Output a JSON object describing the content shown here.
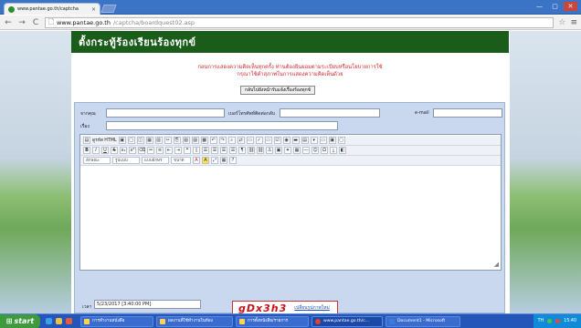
{
  "browser": {
    "tab_title": "www.pantae.go.th/captcha",
    "tab_close": "×",
    "window_buttons": [
      "—",
      "▢",
      "✕"
    ],
    "back_icon": "←",
    "forward_icon": "→",
    "reload_icon": "C",
    "url_host": "www.pantae.go.th",
    "url_path": "/captcha/boardquest02.asp",
    "bookmark_icon": "☆",
    "menu_icon": "≡"
  },
  "page": {
    "banner_title": "ตั้งกระทู้ร้องเรียนร้องทุกข์",
    "notice_line1": "ก่อนการแสดงความคิดเห็นทุกครั้ง ท่านต้องยินยอมตามระเบียบหรือนโยบายการใช้",
    "notice_line2": "กรุณาใช้คำสุภาพในการแสดงความคิดเห็นด้วย",
    "back_button": "กลับไปยังหน้ารับแจ้งเรื่องร้องทุกข์",
    "form": {
      "from_label": "จากคุณ",
      "phone_label": "เบอร์โทรศัพท์ติดต่อกลับ",
      "email_label": "e-mail",
      "subject_label": "เรื่อง",
      "date_label": "เวลา",
      "date_value": "5/23/2017 [3:40:00 PM]",
      "toolbar": {
        "source_label": "ดูรหัส HTML",
        "style_label": "ลักษณะ",
        "format_label": "รูปแบบ",
        "font_label": "แบบอักษร",
        "size_label": "ขนาด"
      },
      "resize_grip": "◢"
    },
    "captcha": {
      "code": "gDx3h3",
      "refresh_label": "เปลี่ยนรูปภาพใหม่"
    }
  },
  "taskbar": {
    "start_label": "start",
    "tasks": [
      "การทำงานหนังสือ",
      "ผลงานที่ใช้ทำงานในห้อง",
      "การตั้งหนังสือ/รายการ",
      "www.pantae.go.th/c...",
      "Document1 - Microsoft"
    ],
    "tray_lang": "TH",
    "tray_time": "15:40"
  },
  "colors": {
    "banner": "#1a5c1a",
    "notice": "#d3262a",
    "form_bg": "#c9d8ef",
    "taskbar": "#2356b8",
    "start": "#3f9a3d"
  }
}
